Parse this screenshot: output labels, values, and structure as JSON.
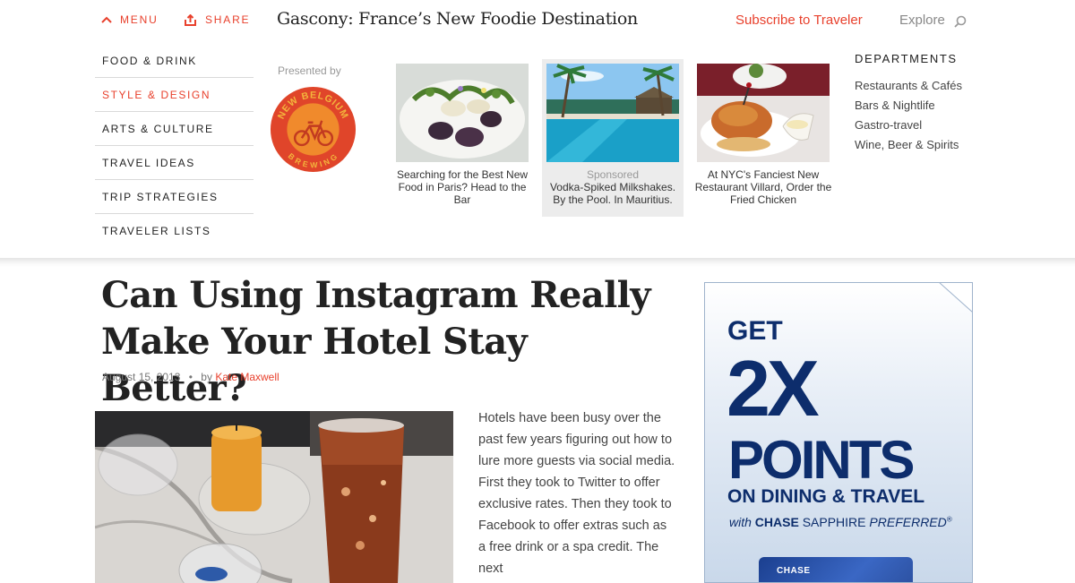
{
  "header": {
    "menu_label": "MENU",
    "share_label": "SHARE",
    "headline": "Gascony: France’s New Foodie Destination",
    "subscribe_label": "Subscribe to Traveler",
    "explore_label": "Explore"
  },
  "menu": {
    "categories": [
      {
        "label": "FOOD & DRINK",
        "active": false
      },
      {
        "label": "STYLE & DESIGN",
        "active": true
      },
      {
        "label": "ARTS & CULTURE",
        "active": false
      },
      {
        "label": "TRAVEL IDEAS",
        "active": false
      },
      {
        "label": "TRIP STRATEGIES",
        "active": false
      },
      {
        "label": "TRAVELER LISTS",
        "active": false
      }
    ],
    "presented_by": "Presented by",
    "sponsor_logo": {
      "top_text": "NEW BELGIUM",
      "bottom_text": "BREWING",
      "colors": {
        "ring": "#e0452a",
        "inner": "#f08a2c",
        "accent": "#f3b43c"
      }
    },
    "features": [
      {
        "caption": "Searching for the Best New Food in Paris? Head to the Bar",
        "sponsored": false
      },
      {
        "sponsored_label": "Sponsored",
        "caption": "Vodka-Spiked Milkshakes. By the Pool. In Mauritius.",
        "sponsored": true
      },
      {
        "caption": "At NYC's Fanciest New Restaurant Villard, Order the Fried Chicken",
        "sponsored": false
      }
    ],
    "departments": {
      "title": "DEPARTMENTS",
      "items": [
        "Restaurants & Cafés",
        "Bars & Nightlife",
        "Gastro-travel",
        "Wine, Beer & Spirits"
      ]
    }
  },
  "article": {
    "title": "Can Using Instagram Really Make Your Hotel Stay Better?",
    "date": "August 15, 2013",
    "by": "by",
    "author": "Kate Maxwell",
    "body": "Hotels have been busy over the past few years figuring out how to lure more guests via social media. First they took to Twitter to offer exclusive rates. Then they took to Facebook to offer extras such as a free drink or a spa credit. The next"
  },
  "ad": {
    "line1": "GET",
    "line2": "2X",
    "line3": "POINTS",
    "line4": "ON DINING & TRAVEL",
    "with": "with",
    "brand": "CHASE",
    "product": "SAPPHIRE",
    "tier": "PREFERRED",
    "reg": "®",
    "card_text": "CHASE",
    "colors": {
      "text": "#0d2d6c",
      "card": "#2b4f9e"
    }
  },
  "colors": {
    "accent": "#e8402c",
    "text": "#222222",
    "muted": "#999999"
  }
}
